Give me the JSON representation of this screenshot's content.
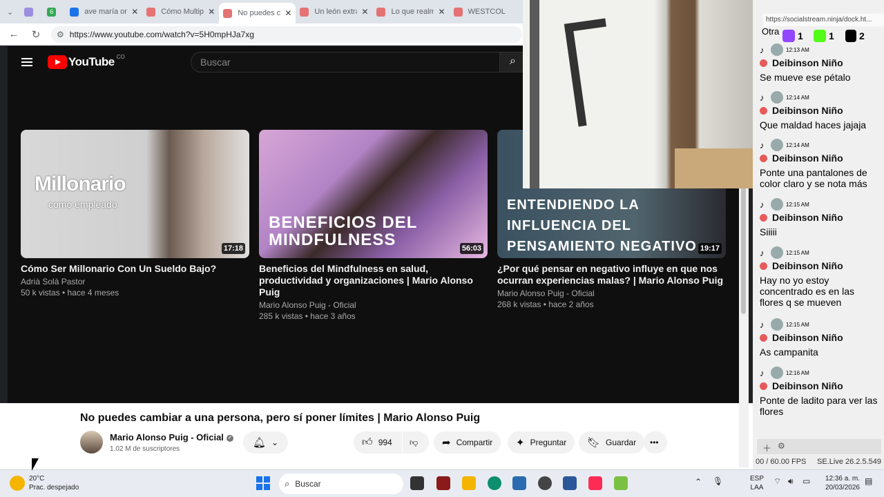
{
  "browser": {
    "tabs": [
      {
        "title": "",
        "favicon": "#9b8ee0"
      },
      {
        "title": "6",
        "favicon": "#34a853"
      },
      {
        "title": "ave maría orac",
        "favicon": "#1a73e8"
      },
      {
        "title": "Cómo Multipl",
        "favicon": "#e57373"
      },
      {
        "title": "No puedes ca",
        "favicon": "#e57373"
      },
      {
        "title": "Un león extra",
        "favicon": "#e57373"
      },
      {
        "title": "Lo que realme",
        "favicon": "#e57373"
      },
      {
        "title": "WESTCOL",
        "favicon": "#e57373"
      }
    ],
    "url": "https://www.youtube.com/watch?v=5H0mpHJa7xg"
  },
  "youtube": {
    "country": "CO",
    "search_placeholder": "Buscar",
    "cards": [
      {
        "thumb_title": "Millonario",
        "thumb_sub": "como empleado",
        "duration": "17:18",
        "title": "Cómo Ser Millonario Con Un Sueldo Bajo?",
        "channel": "Adrià Solà Pastor",
        "meta": "50 k vistas • hace 4 meses"
      },
      {
        "thumb_title": "BENEFICIOS DEL MINDFULNESS",
        "duration": "56:03",
        "title": "Beneficios del Mindfulness en salud, productividad y organizaciones | Mario Alonso Puig",
        "channel": "Mario Alonso Puig - Oficial",
        "meta": "285 k vistas • hace 3 años"
      },
      {
        "thumb_title": "ENTENDIENDO LA INFLUENCIA DEL PENSAMIENTO NEGATIVO",
        "duration": "19:17",
        "title": "¿Por qué pensar en negativo influye en que nos ocurran experiencias malas? | Mario Alonso Puig",
        "channel": "Mario Alonso Puig - Oficial",
        "meta": "268 k vistas • hace 2 años"
      }
    ],
    "video_title": "No puedes cambiar a una persona, pero sí poner límites | Mario Alonso Puig",
    "channel_name": "Mario Alonso Puig - Oficial",
    "subscribers": "1.02 M de suscriptores",
    "likes": "994",
    "share": "Compartir",
    "ask": "Preguntar",
    "save": "Guardar"
  },
  "chat": {
    "url": "https://socialstream.ninja/dock.ht...",
    "counts": {
      "twitch": "1",
      "kick": "1",
      "tiktok": "2"
    },
    "partial_top": "Otra",
    "messages": [
      {
        "time": "12:13 AM",
        "name": "Deibinson Niño",
        "text": "Se mueve ese pétalo"
      },
      {
        "time": "12:14 AM",
        "name": "Deibinson Niño",
        "text": "Que maldad haces jajaja"
      },
      {
        "time": "12:14 AM",
        "name": "Deibinson Niño",
        "text": "Ponte una pantalones de color claro y se nota más"
      },
      {
        "time": "12:15 AM",
        "name": "Deibinson Niño",
        "text": "Siiiii"
      },
      {
        "time": "12:15 AM",
        "name": "Deibinson Niño",
        "text": "Hay no yo estoy concentrado es en las flores q se mueven"
      },
      {
        "time": "12:15 AM",
        "name": "Deibinson Niño",
        "text": "As campanita"
      },
      {
        "time": "12:16 AM",
        "name": "Deibinson Niño",
        "text": "Ponte de ladito para ver las flores"
      }
    ],
    "fps": "00 / 60.00 FPS",
    "version": "SE.Live 26.2.5.549"
  },
  "taskbar": {
    "temp": "20°C",
    "weather": "Prac. despejado",
    "search": "Buscar",
    "lang1": "ESP",
    "lang2": "LAA",
    "time": "12:36 a. m.",
    "date": "20/03/2026"
  }
}
